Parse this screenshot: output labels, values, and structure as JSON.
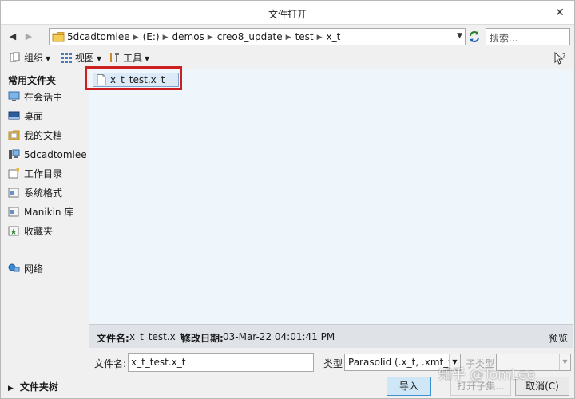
{
  "window": {
    "title": "文件打开",
    "close": "✕"
  },
  "nav": {
    "back": "◀",
    "forward": "▶"
  },
  "address": {
    "crumbs": [
      "5dcadtomlee",
      "(E:)",
      "demos",
      "creo8_update",
      "test",
      "x_t"
    ],
    "separator": "▶",
    "dropdown": "▼"
  },
  "search": {
    "placeholder": "搜索..."
  },
  "toolbar": {
    "organize": "组织",
    "view": "视图",
    "tools": "工具",
    "caret": "▼"
  },
  "sidebar": {
    "header": "常用文件夹",
    "items": [
      {
        "label": "在会话中",
        "icon": "monitor-icon"
      },
      {
        "label": "桌面",
        "icon": "desktop-icon"
      },
      {
        "label": "我的文档",
        "icon": "documents-icon"
      },
      {
        "label": "5dcadtomlee",
        "icon": "computer-icon"
      },
      {
        "label": "工作目录",
        "icon": "working-dir-icon"
      },
      {
        "label": "系统格式",
        "icon": "system-format-icon"
      },
      {
        "label": "Manikin 库",
        "icon": "library-icon"
      },
      {
        "label": "收藏夹",
        "icon": "favorites-icon"
      },
      {
        "label": "网络",
        "icon": "network-icon"
      }
    ]
  },
  "files": [
    {
      "name": "x_t_test.x_t"
    }
  ],
  "info": {
    "filename_label": "文件名:",
    "filename_value": "x_t_test.x_t",
    "modified_label": "修改日期:",
    "modified_value": "03-Mar-22 04:01:41 PM",
    "preview": "预览"
  },
  "form": {
    "filename_label": "文件名:",
    "filename_value": "x_t_test.x_t",
    "type_label": "类型",
    "type_value": "Parasolid (.x_t, .xmt_txt)",
    "subtype_label": "子类型",
    "subtype_value": ""
  },
  "footer": {
    "folder_tree": "文件夹树",
    "tree_caret": "▶",
    "import": "导入",
    "open_sub": "打开子集...",
    "cancel": "取消(C)"
  },
  "watermark": "知乎 @TomLee",
  "colors": {
    "highlight_border": "#cc1f1f",
    "selected_bg": "#dceaf7",
    "primary_button": "#cfe6f7"
  }
}
